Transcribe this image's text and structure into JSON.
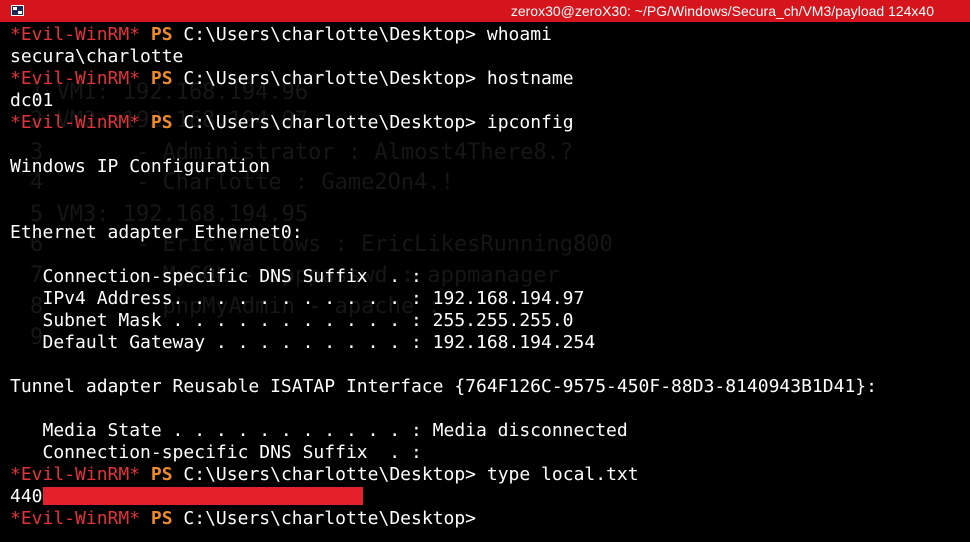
{
  "window": {
    "title": "zerox30@zeroX30: ~/PG/Windows/Secura_ch/VM3/payload 124x40"
  },
  "background_text": [
    "1 VM1: 192.168.194.96",
    "2 VM2: 192.168.194.97",
    "3       - Administrator : Almost4There8.?",
    "4       - Charlotte : Game2On4.!",
    "5 VM3: 192.168.194.95",
    "6       - Eric.Wallows : EricLikesRunning800",
    "7       - MySQL - apppasswd : appmanager",
    "8         phpMyAdmin - apache :",
    "9"
  ],
  "terminal": {
    "prompt": {
      "name": "*Evil-WinRM*",
      "ps": "PS",
      "path": "C:\\Users\\charlotte\\Desktop>"
    },
    "lines": [
      {
        "type": "prompt",
        "cmd": "whoami"
      },
      {
        "type": "output",
        "text": "secura\\charlotte"
      },
      {
        "type": "prompt",
        "cmd": "hostname"
      },
      {
        "type": "output",
        "text": "dc01"
      },
      {
        "type": "prompt",
        "cmd": "ipconfig"
      },
      {
        "type": "output",
        "text": ""
      },
      {
        "type": "output",
        "text": "Windows IP Configuration"
      },
      {
        "type": "output",
        "text": ""
      },
      {
        "type": "output",
        "text": ""
      },
      {
        "type": "output",
        "text": "Ethernet adapter Ethernet0:"
      },
      {
        "type": "output",
        "text": ""
      },
      {
        "type": "output",
        "text": "   Connection-specific DNS Suffix  . :"
      },
      {
        "type": "output",
        "text": "   IPv4 Address. . . . . . . . . . . : 192.168.194.97"
      },
      {
        "type": "output",
        "text": "   Subnet Mask . . . . . . . . . . . : 255.255.255.0"
      },
      {
        "type": "output",
        "text": "   Default Gateway . . . . . . . . . : 192.168.194.254"
      },
      {
        "type": "output",
        "text": ""
      },
      {
        "type": "output",
        "text": "Tunnel adapter Reusable ISATAP Interface {764F126C-9575-450F-88D3-8140943B1D41}:"
      },
      {
        "type": "output",
        "text": ""
      },
      {
        "type": "output",
        "text": "   Media State . . . . . . . . . . . : Media disconnected"
      },
      {
        "type": "output",
        "text": "   Connection-specific DNS Suffix  . :"
      },
      {
        "type": "prompt",
        "cmd": "type local.txt"
      },
      {
        "type": "redacted",
        "text": "440"
      },
      {
        "type": "prompt",
        "cmd": ""
      }
    ]
  }
}
